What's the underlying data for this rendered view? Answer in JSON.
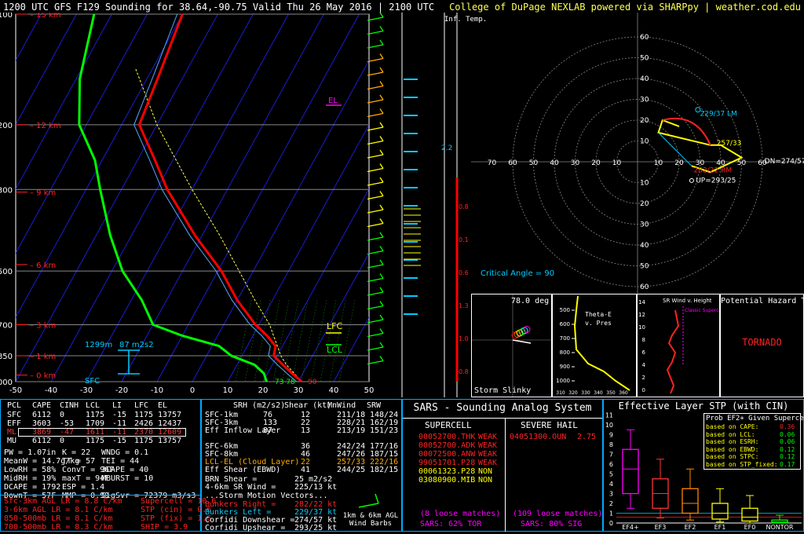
{
  "header": {
    "title": "1200 UTC GFS F129 Sounding for 38.64,-90.75 Valid  Thu 26 May 2016 | 2100 UTC",
    "credit": "College of DuPage NEXLAB powered via SHARPpy | weather.cod.edu"
  },
  "colors": {
    "temp": "#ff0000",
    "dewp": "#00ff00",
    "parcel": "#ffff55",
    "virtual": "#55aaff",
    "grid": "#2222ff",
    "accent": "#00ffff"
  },
  "chart_data": [
    {
      "type": "line",
      "name": "skewt",
      "pressure_ticks": [
        100,
        200,
        300,
        500,
        700,
        850,
        1000
      ],
      "height_labels": [
        {
          "p": 100,
          "label": "15 km"
        },
        {
          "p": 200,
          "label": "12 km"
        },
        {
          "p": 305,
          "label": "9 km"
        },
        {
          "p": 480,
          "label": "6 km"
        },
        {
          "p": 700,
          "label": "3 km"
        },
        {
          "p": 850,
          "label": "1 km"
        },
        {
          "p": 960,
          "label": "0 km"
        }
      ],
      "temp_ticks": [
        -50,
        -40,
        -30,
        -20,
        -10,
        0,
        10,
        20,
        30,
        40,
        50
      ],
      "temp_profile": [
        [
          1000,
          31
        ],
        [
          950,
          27
        ],
        [
          900,
          23
        ],
        [
          850,
          19
        ],
        [
          800,
          18
        ],
        [
          750,
          14
        ],
        [
          700,
          9
        ],
        [
          600,
          0
        ],
        [
          500,
          -9
        ],
        [
          400,
          -22
        ],
        [
          300,
          -37
        ],
        [
          250,
          -45
        ],
        [
          200,
          -55
        ],
        [
          150,
          -57
        ],
        [
          100,
          -60
        ]
      ],
      "dewp_profile": [
        [
          1000,
          21
        ],
        [
          950,
          19
        ],
        [
          900,
          15
        ],
        [
          850,
          7
        ],
        [
          800,
          2
        ],
        [
          750,
          -10
        ],
        [
          700,
          -20
        ],
        [
          600,
          -27
        ],
        [
          500,
          -37
        ],
        [
          400,
          -46
        ],
        [
          300,
          -56
        ],
        [
          250,
          -62
        ],
        [
          200,
          -72
        ],
        [
          150,
          -79
        ],
        [
          100,
          -85
        ]
      ],
      "parcel_profile": [
        [
          1000,
          31
        ],
        [
          900,
          24
        ],
        [
          850,
          21
        ],
        [
          700,
          13
        ],
        [
          600,
          5
        ],
        [
          500,
          -4
        ],
        [
          400,
          -15
        ],
        [
          300,
          -30
        ],
        [
          200,
          -50
        ],
        [
          140,
          -65
        ]
      ],
      "labels": {
        "el": "EL",
        "lfc": "LFC",
        "lcl": "LCL",
        "sfc": "SFC",
        "hgt": "1299m",
        "cape": "87 m2s2",
        "sfc_t": "90",
        "sfc_td": "73 78"
      }
    },
    {
      "type": "scatter",
      "name": "hodograph",
      "rings": [
        10,
        20,
        30,
        40,
        50,
        60
      ],
      "hodo_trace": [
        [
          26,
          -2
        ],
        [
          35,
          -5
        ],
        [
          50,
          2
        ],
        [
          40,
          8
        ],
        [
          35,
          8
        ],
        [
          10,
          14
        ],
        [
          12,
          20
        ],
        [
          20,
          17
        ]
      ],
      "labels": {
        "lm": "229/37 LM",
        "rm": "282/22 RM",
        "dn": "DN=274/57",
        "up": "UP=293/25",
        "dn_short": "257/33",
        "critical": "Critical Angle = 90"
      }
    }
  ],
  "inflow": {
    "title": "Inf. Temp.",
    "ticks": [
      "0.8",
      "0.1",
      "0.6",
      "1.3",
      "1.0",
      "0.8",
      "0.7"
    ],
    "val": "2.2"
  },
  "slinky": {
    "title": "Storm Slinky",
    "angle": "78.0 deg"
  },
  "thetae": {
    "title": "Theta-E v. Pres",
    "ticks": [
      "310",
      "320",
      "330",
      "340",
      "350",
      "360"
    ],
    "pticks": [
      "500",
      "600",
      "700",
      "800",
      "900",
      "1000"
    ]
  },
  "srwind": {
    "title": "SR Wind v. Height",
    "note": "Classic Supercell",
    "hticks": [
      "14",
      "12",
      "10",
      "8",
      "6",
      "4",
      "2",
      "0"
    ]
  },
  "hazard": {
    "title": "Potential Hazard Type",
    "value": "TORNADO"
  },
  "parcels": {
    "header": [
      "PCL",
      "CAPE",
      "CINH",
      "LCL",
      "LI",
      "LFC",
      "EL"
    ],
    "rows": [
      [
        "SFC",
        "6112",
        "0",
        "1175",
        "-15",
        "1175",
        "13757"
      ],
      [
        "EFF",
        "3603",
        "-53",
        "1709",
        "-11",
        "2426",
        "12437"
      ],
      [
        "ML",
        "3869",
        "-47",
        "1611",
        "-11",
        "2370",
        "12609"
      ],
      [
        "MU",
        "6112",
        "0",
        "1175",
        "-15",
        "1175",
        "13757"
      ]
    ],
    "indices": [
      [
        "PW = 1.07in",
        "K = 22",
        "WNDG = 0.1"
      ],
      [
        "MeanW = 14.7g/kg",
        "TT = 57",
        "TEI = 44"
      ],
      [
        "LowRH = 58%",
        "ConvT = 96F",
        "3CAPE = 40"
      ],
      [
        "MidRH = 19%",
        "maxT = 94F",
        "MBURST = 10"
      ],
      [
        "DCAPE = 1792",
        "ESP = 1.4",
        ""
      ],
      [
        "DownT = 57F",
        "MMP = 0.99",
        "SigSvr = 72379 m3/s3"
      ]
    ],
    "lapse": [
      "Sfc-3km AGL LR = 8.8 C/km",
      "3-6km AGL LR = 8.1 C/km",
      "850-500mb LR = 8.1 C/km",
      "700-500mb LR = 8.3 C/km"
    ],
    "composite": [
      "Supercell = 10.6",
      "STP (cin) = 0.6",
      "STP (fix) = 1.6",
      "SHIP = 3.9"
    ]
  },
  "kinematics": {
    "header": [
      "SRH (m2/s2)",
      "Shear (kt)",
      "MnWind",
      "SRW"
    ],
    "rows": [
      [
        "SFC-1km",
        "76",
        "12",
        "211/18",
        "148/24"
      ],
      [
        "SFC-3km",
        "133",
        "22",
        "228/21",
        "162/19"
      ],
      [
        "Eff Inflow Layer",
        "87",
        "13",
        "213/19",
        "151/23"
      ],
      [
        "",
        "",
        " ",
        "",
        ""
      ],
      [
        "SFC-6km",
        "",
        "36",
        "242/24",
        "177/16"
      ],
      [
        "SFC-8km",
        "",
        "46",
        "247/26",
        "187/15"
      ],
      [
        "LCL-EL (Cloud Layer)",
        "",
        "22",
        "257/33",
        "222/16"
      ],
      [
        "Eff Shear (EBWD)",
        "",
        "41",
        "244/25",
        "182/15"
      ]
    ],
    "extra": [
      [
        "BRN Shear =",
        "25 m2/s2"
      ],
      [
        "4-6km SR Wind =",
        "225/13 kt"
      ]
    ],
    "motion_title": "...Storm Motion Vectors...",
    "motion": [
      [
        "Bunkers Right =",
        "282/22 kt"
      ],
      [
        "Bunkers Left =",
        "229/37 kt"
      ],
      [
        "Corfidi Downshear =",
        "274/57 kt"
      ],
      [
        "Corfidi Upshear =",
        "293/25 kt"
      ]
    ],
    "barb_label": "1km & 6km AGL Wind Barbs"
  },
  "sars": {
    "title": "SARS - Sounding Analog System",
    "supercell_title": "SUPERCELL",
    "hail_title": "SEVERE HAIL",
    "supercell": [
      [
        "00052700.THK",
        "WEAK"
      ],
      [
        "00052700.ADK",
        "WEAK"
      ],
      [
        "00072500.ANW",
        "WEAK"
      ],
      [
        "99051701.P28",
        "WEAK"
      ],
      [
        "00061323.P28",
        "NON"
      ],
      [
        "03080900.MIB",
        "NON"
      ]
    ],
    "hail": [
      [
        "04051300.OUN",
        "2.75"
      ]
    ],
    "sc_matches": "(8 loose matches)",
    "sc_pct": "SARS: 62% TOR",
    "hail_matches": "(109 loose matches)",
    "hail_pct": "SARS: 80% SIG"
  },
  "stp": {
    "title": "Effective Layer STP (with CIN)",
    "prob_title": "Prob EF2+ Given Supercell",
    "probs": [
      [
        "based on CAPE:",
        "0.36"
      ],
      [
        "based on LCL:",
        "0.06"
      ],
      [
        "based on ESRH:",
        "0.06"
      ],
      [
        "based on EBWD:",
        "0.12"
      ],
      [
        "based on STPC:",
        "0.12"
      ],
      [
        "based on STP_fixed:",
        "0.17"
      ]
    ],
    "yticks": [
      "11",
      "10",
      "9",
      "8",
      "7",
      "6",
      "5",
      "4",
      "3",
      "2",
      "1",
      "0"
    ],
    "categories": [
      "EF4+",
      "EF3",
      "EF2",
      "EF1",
      "EF0",
      "NONTOR"
    ],
    "boxes": [
      [
        1.5,
        3.0,
        5.5,
        7.5,
        9.5
      ],
      [
        0.5,
        1.5,
        3.0,
        4.5,
        6.5
      ],
      [
        0.3,
        1.0,
        2.0,
        3.5,
        5.5
      ],
      [
        0.1,
        0.4,
        1.0,
        2.0,
        3.5
      ],
      [
        0.0,
        0.2,
        0.6,
        1.5,
        2.8
      ],
      [
        0.0,
        0.0,
        0.1,
        0.3,
        0.8
      ]
    ],
    "box_colors": [
      "#ff00ff",
      "#ff3333",
      "#ff8800",
      "#ffff00",
      "#ffff00",
      "#00ff00"
    ]
  }
}
